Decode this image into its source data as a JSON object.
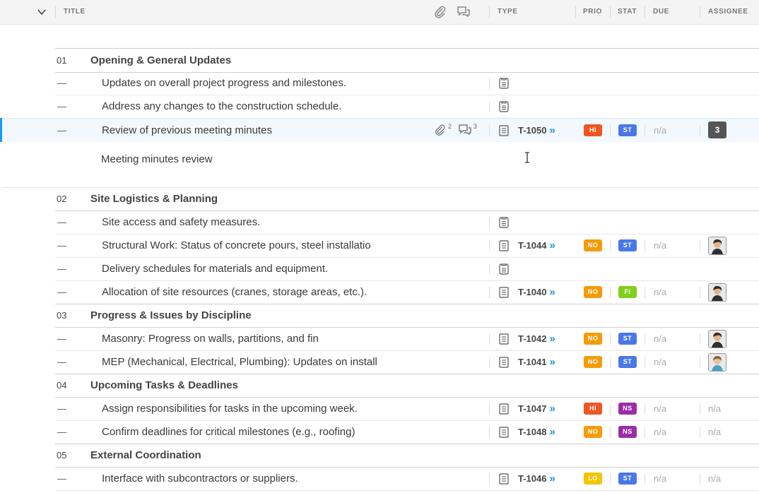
{
  "header": {
    "columns": {
      "title": "TITLE",
      "type": "TYPE",
      "prio": "PRIO",
      "stat": "STAT",
      "due": "DUE",
      "assignee": "ASSIGNEE"
    }
  },
  "colors": {
    "hi": "#f05522",
    "no": "#f59b0a",
    "lo": "#f5c400",
    "st": "#4a78e8",
    "fi": "#7fd11b",
    "ns": "#9a2ea6",
    "accent": "#1a9cf0"
  },
  "sections": [
    {
      "num": "01",
      "title": "Opening & General Updates"
    },
    {
      "num": "02",
      "title": "Site Logistics & Planning"
    },
    {
      "num": "03",
      "title": "Progress & Issues by Discipline"
    },
    {
      "num": "04",
      "title": "Upcoming Tasks & Deadlines"
    },
    {
      "num": "05",
      "title": "External Coordination"
    }
  ],
  "rows": [
    {
      "dash": "—",
      "title": "Updates on overall project progress and milestones."
    },
    {
      "dash": "—",
      "title": "Address any changes to the construction schedule."
    },
    {
      "dash": "—",
      "title": "Review of previous meeting minutes",
      "attach_count": "2",
      "comment_count": "3",
      "id": "T-1050",
      "prio": "HI",
      "stat": "ST",
      "due": "n/a",
      "assignee_count": "3"
    },
    {
      "dash": "—",
      "title": "Site access and safety measures."
    },
    {
      "dash": "—",
      "title": "Structural Work: Status of concrete pours, steel installatio",
      "id": "T-1044",
      "prio": "NO",
      "stat": "ST",
      "due": "n/a"
    },
    {
      "dash": "—",
      "title": "Delivery schedules for materials and equipment."
    },
    {
      "dash": "—",
      "title": "Allocation of site resources (cranes, storage areas, etc.).",
      "id": "T-1040",
      "prio": "NO",
      "stat": "FI",
      "due": "n/a"
    },
    {
      "dash": "—",
      "title": "Masonry: Progress on walls, partitions, and fin",
      "id": "T-1042",
      "prio": "NO",
      "stat": "ST",
      "due": "n/a"
    },
    {
      "dash": "—",
      "title": "MEP (Mechanical, Electrical, Plumbing): Updates on install",
      "id": "T-1041",
      "prio": "NO",
      "stat": "ST",
      "due": "n/a"
    },
    {
      "dash": "—",
      "title": "Assign responsibilities for tasks in the upcoming week.",
      "id": "T-1047",
      "prio": "HI",
      "stat": "NS",
      "due": "n/a",
      "assignee": "n/a"
    },
    {
      "dash": "—",
      "title": "Confirm deadlines for critical milestones (e.g., roofing)",
      "id": "T-1048",
      "prio": "NO",
      "stat": "NS",
      "due": "n/a",
      "assignee": "n/a"
    },
    {
      "dash": "—",
      "title": "Interface with subcontractors or suppliers.",
      "id": "T-1046",
      "prio": "LO",
      "stat": "ST",
      "due": "n/a",
      "assignee": "n/a"
    }
  ],
  "expanded": {
    "description": "Meeting minutes review"
  },
  "arrow": "»"
}
